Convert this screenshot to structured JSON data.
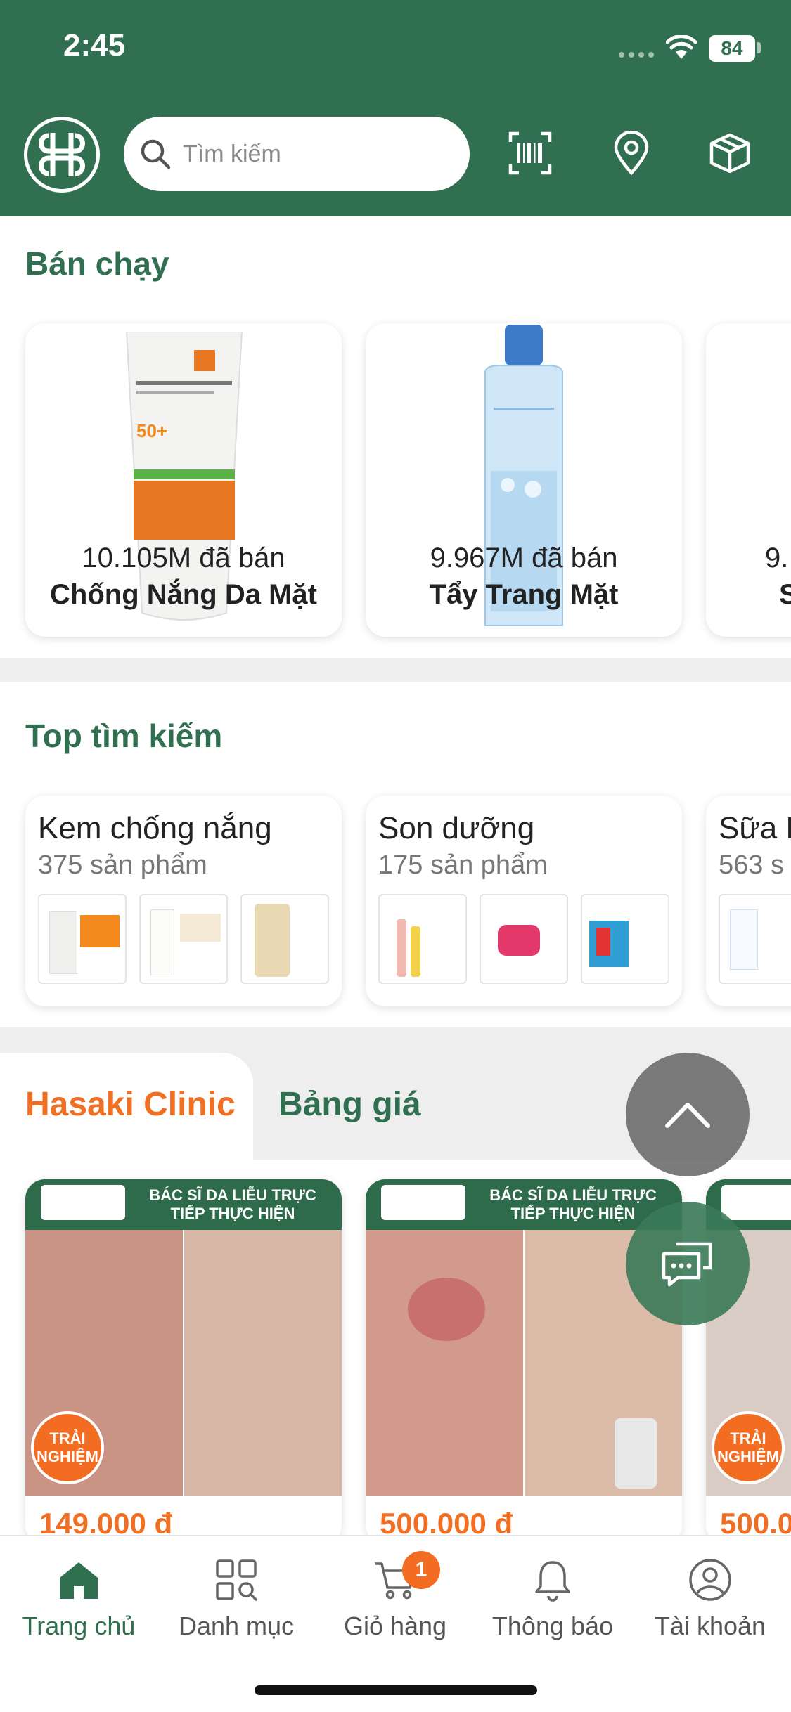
{
  "status_bar": {
    "time": "2:45",
    "battery": "84"
  },
  "header": {
    "search_placeholder": "Tìm kiếm",
    "icons": [
      "hasaki-logo",
      "barcode-scan-icon",
      "location-pin-icon",
      "box-icon"
    ]
  },
  "best_sellers": {
    "title": "Bán chạy",
    "items": [
      {
        "sold": "10.105M đã bán",
        "name": "Chống Nắng Da Mặt"
      },
      {
        "sold": "9.967M đã bán",
        "name": "Tẩy Trang Mặt"
      },
      {
        "sold": "9.",
        "name": "S"
      }
    ]
  },
  "top_search": {
    "title": "Top tìm kiếm",
    "items": [
      {
        "name": "Kem chống nắng",
        "count": "375 sản phẩm"
      },
      {
        "name": "Son dưỡng",
        "count": "175 sản phẩm"
      },
      {
        "name": "Sữa R",
        "count": "563 s"
      }
    ]
  },
  "clinic": {
    "tabs": [
      "Hasaki Clinic",
      "Bảng giá"
    ],
    "banner_text": "BÁC SĨ DA LIỄU TRỰC TIẾP THỰC HIỆN",
    "badge_text": "TRẢI NGHIỆM",
    "items": [
      {
        "price": "149.000 đ"
      },
      {
        "price": "500.000 đ"
      },
      {
        "price": "500.0"
      }
    ]
  },
  "bottom_nav": {
    "items": [
      {
        "label": "Trang chủ",
        "icon": "home-icon",
        "active": true
      },
      {
        "label": "Danh mục",
        "icon": "category-icon"
      },
      {
        "label": "Giỏ hàng",
        "icon": "cart-icon",
        "badge": "1"
      },
      {
        "label": "Thông báo",
        "icon": "bell-icon"
      },
      {
        "label": "Tài khoản",
        "icon": "user-icon"
      }
    ]
  },
  "colors": {
    "brand_green": "#306f4f",
    "accent_orange": "#f26c22"
  }
}
